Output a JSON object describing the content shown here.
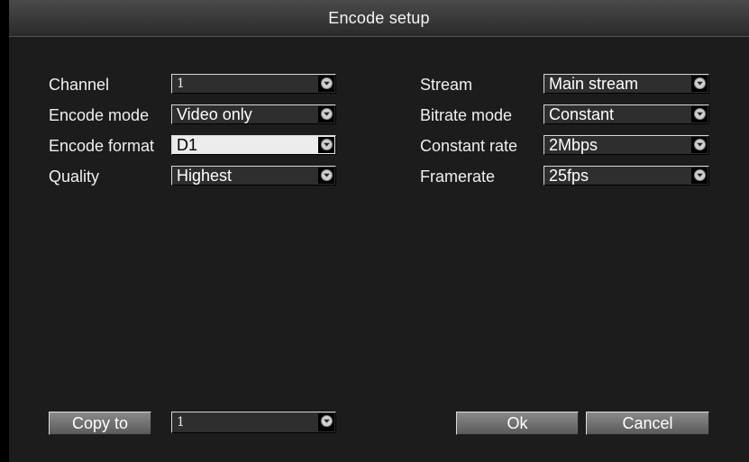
{
  "window": {
    "title": "Encode setup"
  },
  "left": {
    "channel": {
      "label": "Channel",
      "value": "1"
    },
    "encode_mode": {
      "label": "Encode mode",
      "value": "Video only"
    },
    "encode_format": {
      "label": "Encode format",
      "value": "D1"
    },
    "quality": {
      "label": "Quality",
      "value": "Highest"
    }
  },
  "right": {
    "stream": {
      "label": "Stream",
      "value": "Main stream"
    },
    "bitrate_mode": {
      "label": "Bitrate mode",
      "value": "Constant"
    },
    "constant_rate": {
      "label": "Constant rate",
      "value": "2Mbps"
    },
    "framerate": {
      "label": "Framerate",
      "value": "25fps"
    }
  },
  "footer": {
    "copy_to_label": "Copy to",
    "copy_to_value": "1",
    "ok_label": "Ok",
    "cancel_label": "Cancel"
  },
  "icons": {
    "dropdown": "chevron-down-icon"
  },
  "colors": {
    "background": "#1c1c1c",
    "titlebar": "#3a3a3a",
    "field": "#2e2e2e",
    "field_selected": "#ececec",
    "button": "#707070"
  }
}
